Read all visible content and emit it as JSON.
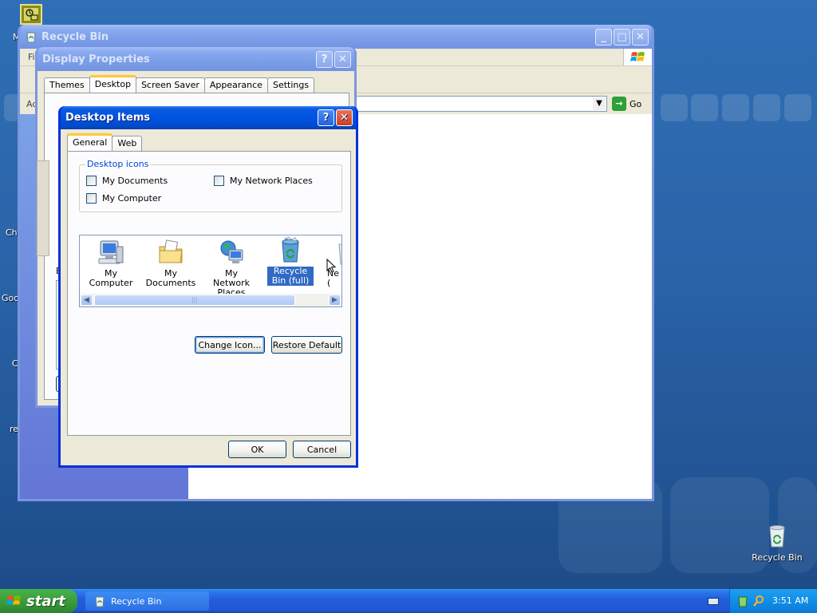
{
  "desktop": {
    "labels": [
      {
        "text": "M",
        "name": "desktop-label-m"
      },
      {
        "text": "Chr",
        "name": "desktop-label-chr"
      },
      {
        "text": "Goo",
        "name": "desktop-label-goo"
      },
      {
        "text": "C",
        "name": "desktop-label-c"
      },
      {
        "text": "re",
        "name": "desktop-label-re"
      }
    ],
    "recycle_bin_label": "Recycle Bin"
  },
  "recycle_window": {
    "title": "Recycle Bin",
    "menu_partial": "Fi",
    "address_partial": "Ad",
    "go_label": "Go"
  },
  "display_properties": {
    "title": "Display Properties",
    "tabs": [
      "Themes",
      "Desktop",
      "Screen Saver",
      "Appearance",
      "Settings"
    ],
    "active_tab": "Desktop",
    "partial_label": "B"
  },
  "desktop_items": {
    "title": "Desktop Items",
    "tabs": [
      "General",
      "Web"
    ],
    "active_tab": "General",
    "group_title": "Desktop icons",
    "checkboxes": [
      {
        "label": "My Documents",
        "checked": false
      },
      {
        "label": "My Network Places",
        "checked": false
      },
      {
        "label": "My Computer",
        "checked": false
      }
    ],
    "icons": [
      {
        "label": "My Computer",
        "icon": "my-computer-icon"
      },
      {
        "label": "My Documents",
        "icon": "my-documents-icon"
      },
      {
        "label": "My Network Places",
        "icon": "network-places-icon"
      },
      {
        "label": "Recycle Bin (full)",
        "icon": "recycle-bin-full-icon",
        "selected": true
      },
      {
        "label": "Ne (",
        "icon": "recycle-bin-empty-icon"
      }
    ],
    "change_icon_label": "Change Icon...",
    "restore_default_label": "Restore Default",
    "ok_label": "OK",
    "cancel_label": "Cancel"
  },
  "taskbar": {
    "start_label": "start",
    "task_item_label": "Recycle Bin",
    "clock": "3:51 AM"
  },
  "colors": {
    "xp_blue": "#0054e3",
    "selection": "#316ac5",
    "dialog_face": "#ece9d8",
    "tab_accent": "#ffc83c",
    "start_green": "#3c9c3c"
  }
}
